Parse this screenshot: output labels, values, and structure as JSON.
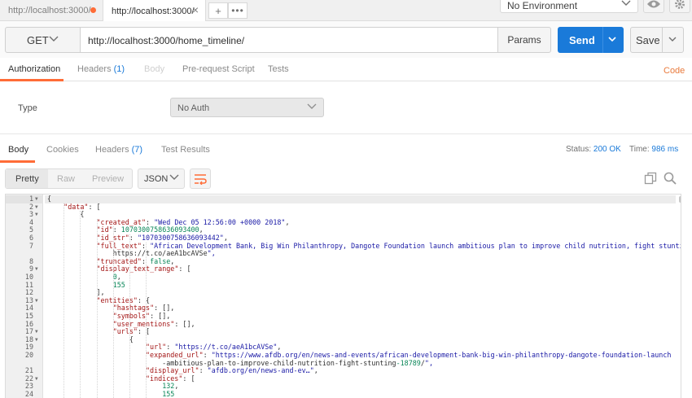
{
  "tabs": [
    {
      "label": "http://localhost:3000/",
      "state": "unsaved-dot"
    },
    {
      "label": "http://localhost:3000/",
      "state": "active"
    }
  ],
  "tab_actions": {
    "new_tab_icon": "+",
    "more_icon": "•••"
  },
  "environment": {
    "selected": "No Environment"
  },
  "request": {
    "method": "GET",
    "url": "http://localhost:3000/home_timeline/",
    "params_label": "Params",
    "send_label": "Send",
    "save_label": "Save"
  },
  "request_tabs": [
    {
      "label": "Authorization",
      "count": "",
      "state": "active"
    },
    {
      "label": "Headers",
      "count": "(1)",
      "state": "normal"
    },
    {
      "label": "Body",
      "count": "",
      "state": "disabled"
    },
    {
      "label": "Pre-request Script",
      "count": "",
      "state": "normal"
    },
    {
      "label": "Tests",
      "count": "",
      "state": "normal"
    }
  ],
  "code_link": "Code",
  "auth": {
    "type_label": "Type",
    "type_value": "No Auth"
  },
  "response_tabs": [
    {
      "label": "Body",
      "count": "",
      "state": "active"
    },
    {
      "label": "Cookies",
      "count": "",
      "state": "normal"
    },
    {
      "label": "Headers",
      "count": "(7)",
      "state": "normal"
    },
    {
      "label": "Test Results",
      "count": "",
      "state": "normal"
    }
  ],
  "response_meta": {
    "status_label": "Status:",
    "status_value": "200 OK",
    "time_label": "Time:",
    "time_value": "986 ms"
  },
  "view_modes": {
    "pretty": "Pretty",
    "raw": "Raw",
    "preview": "Preview",
    "format": "JSON"
  },
  "colors": {
    "accent_orange": "#ff6c37",
    "send_blue": "#1a7ad9",
    "link_blue": "#1a7ad9"
  },
  "code_lines": [
    {
      "n": "1",
      "fold": true,
      "text": "{"
    },
    {
      "n": "2",
      "fold": true,
      "text": "    \"data\": ["
    },
    {
      "n": "3",
      "fold": true,
      "text": "        {"
    },
    {
      "n": "4",
      "fold": false,
      "text": "            \"created_at\": \"Wed Dec 05 12:56:00 +0000 2018\","
    },
    {
      "n": "5",
      "fold": false,
      "text": "            \"id\": 1070300758636093400,"
    },
    {
      "n": "6",
      "fold": false,
      "text": "            \"id_str\": \"1070300758636093442\","
    },
    {
      "n": "7",
      "fold": false,
      "text": "            \"full_text\": \"African Development Bank, Big Win Philanthropy, Dangote Foundation launch ambitious plan to improve child nutrition, fight stunting"
    },
    {
      "n": "",
      "fold": false,
      "text": "                https://t.co/aeA1bcAVSe\","
    },
    {
      "n": "8",
      "fold": false,
      "text": "            \"truncated\": false,"
    },
    {
      "n": "9",
      "fold": true,
      "text": "            \"display_text_range\": ["
    },
    {
      "n": "10",
      "fold": false,
      "text": "                0,"
    },
    {
      "n": "11",
      "fold": false,
      "text": "                155"
    },
    {
      "n": "12",
      "fold": false,
      "text": "            ],"
    },
    {
      "n": "13",
      "fold": true,
      "text": "            \"entities\": {"
    },
    {
      "n": "14",
      "fold": false,
      "text": "                \"hashtags\": [],"
    },
    {
      "n": "15",
      "fold": false,
      "text": "                \"symbols\": [],"
    },
    {
      "n": "16",
      "fold": false,
      "text": "                \"user_mentions\": [],"
    },
    {
      "n": "17",
      "fold": true,
      "text": "                \"urls\": ["
    },
    {
      "n": "18",
      "fold": true,
      "text": "                    {"
    },
    {
      "n": "19",
      "fold": false,
      "text": "                        \"url\": \"https://t.co/aeA1bcAVSe\","
    },
    {
      "n": "20",
      "fold": false,
      "text": "                        \"expanded_url\": \"https://www.afdb.org/en/news-and-events/african-development-bank-big-win-philanthropy-dangote-foundation-launch"
    },
    {
      "n": "",
      "fold": false,
      "text": "                            -ambitious-plan-to-improve-child-nutrition-fight-stunting-18789/\","
    },
    {
      "n": "21",
      "fold": false,
      "text": "                        \"display_url\": \"afdb.org/en/news-and-ev…\","
    },
    {
      "n": "22",
      "fold": true,
      "text": "                        \"indices\": ["
    },
    {
      "n": "23",
      "fold": false,
      "text": "                            132,"
    },
    {
      "n": "24",
      "fold": false,
      "text": "                            155"
    }
  ]
}
